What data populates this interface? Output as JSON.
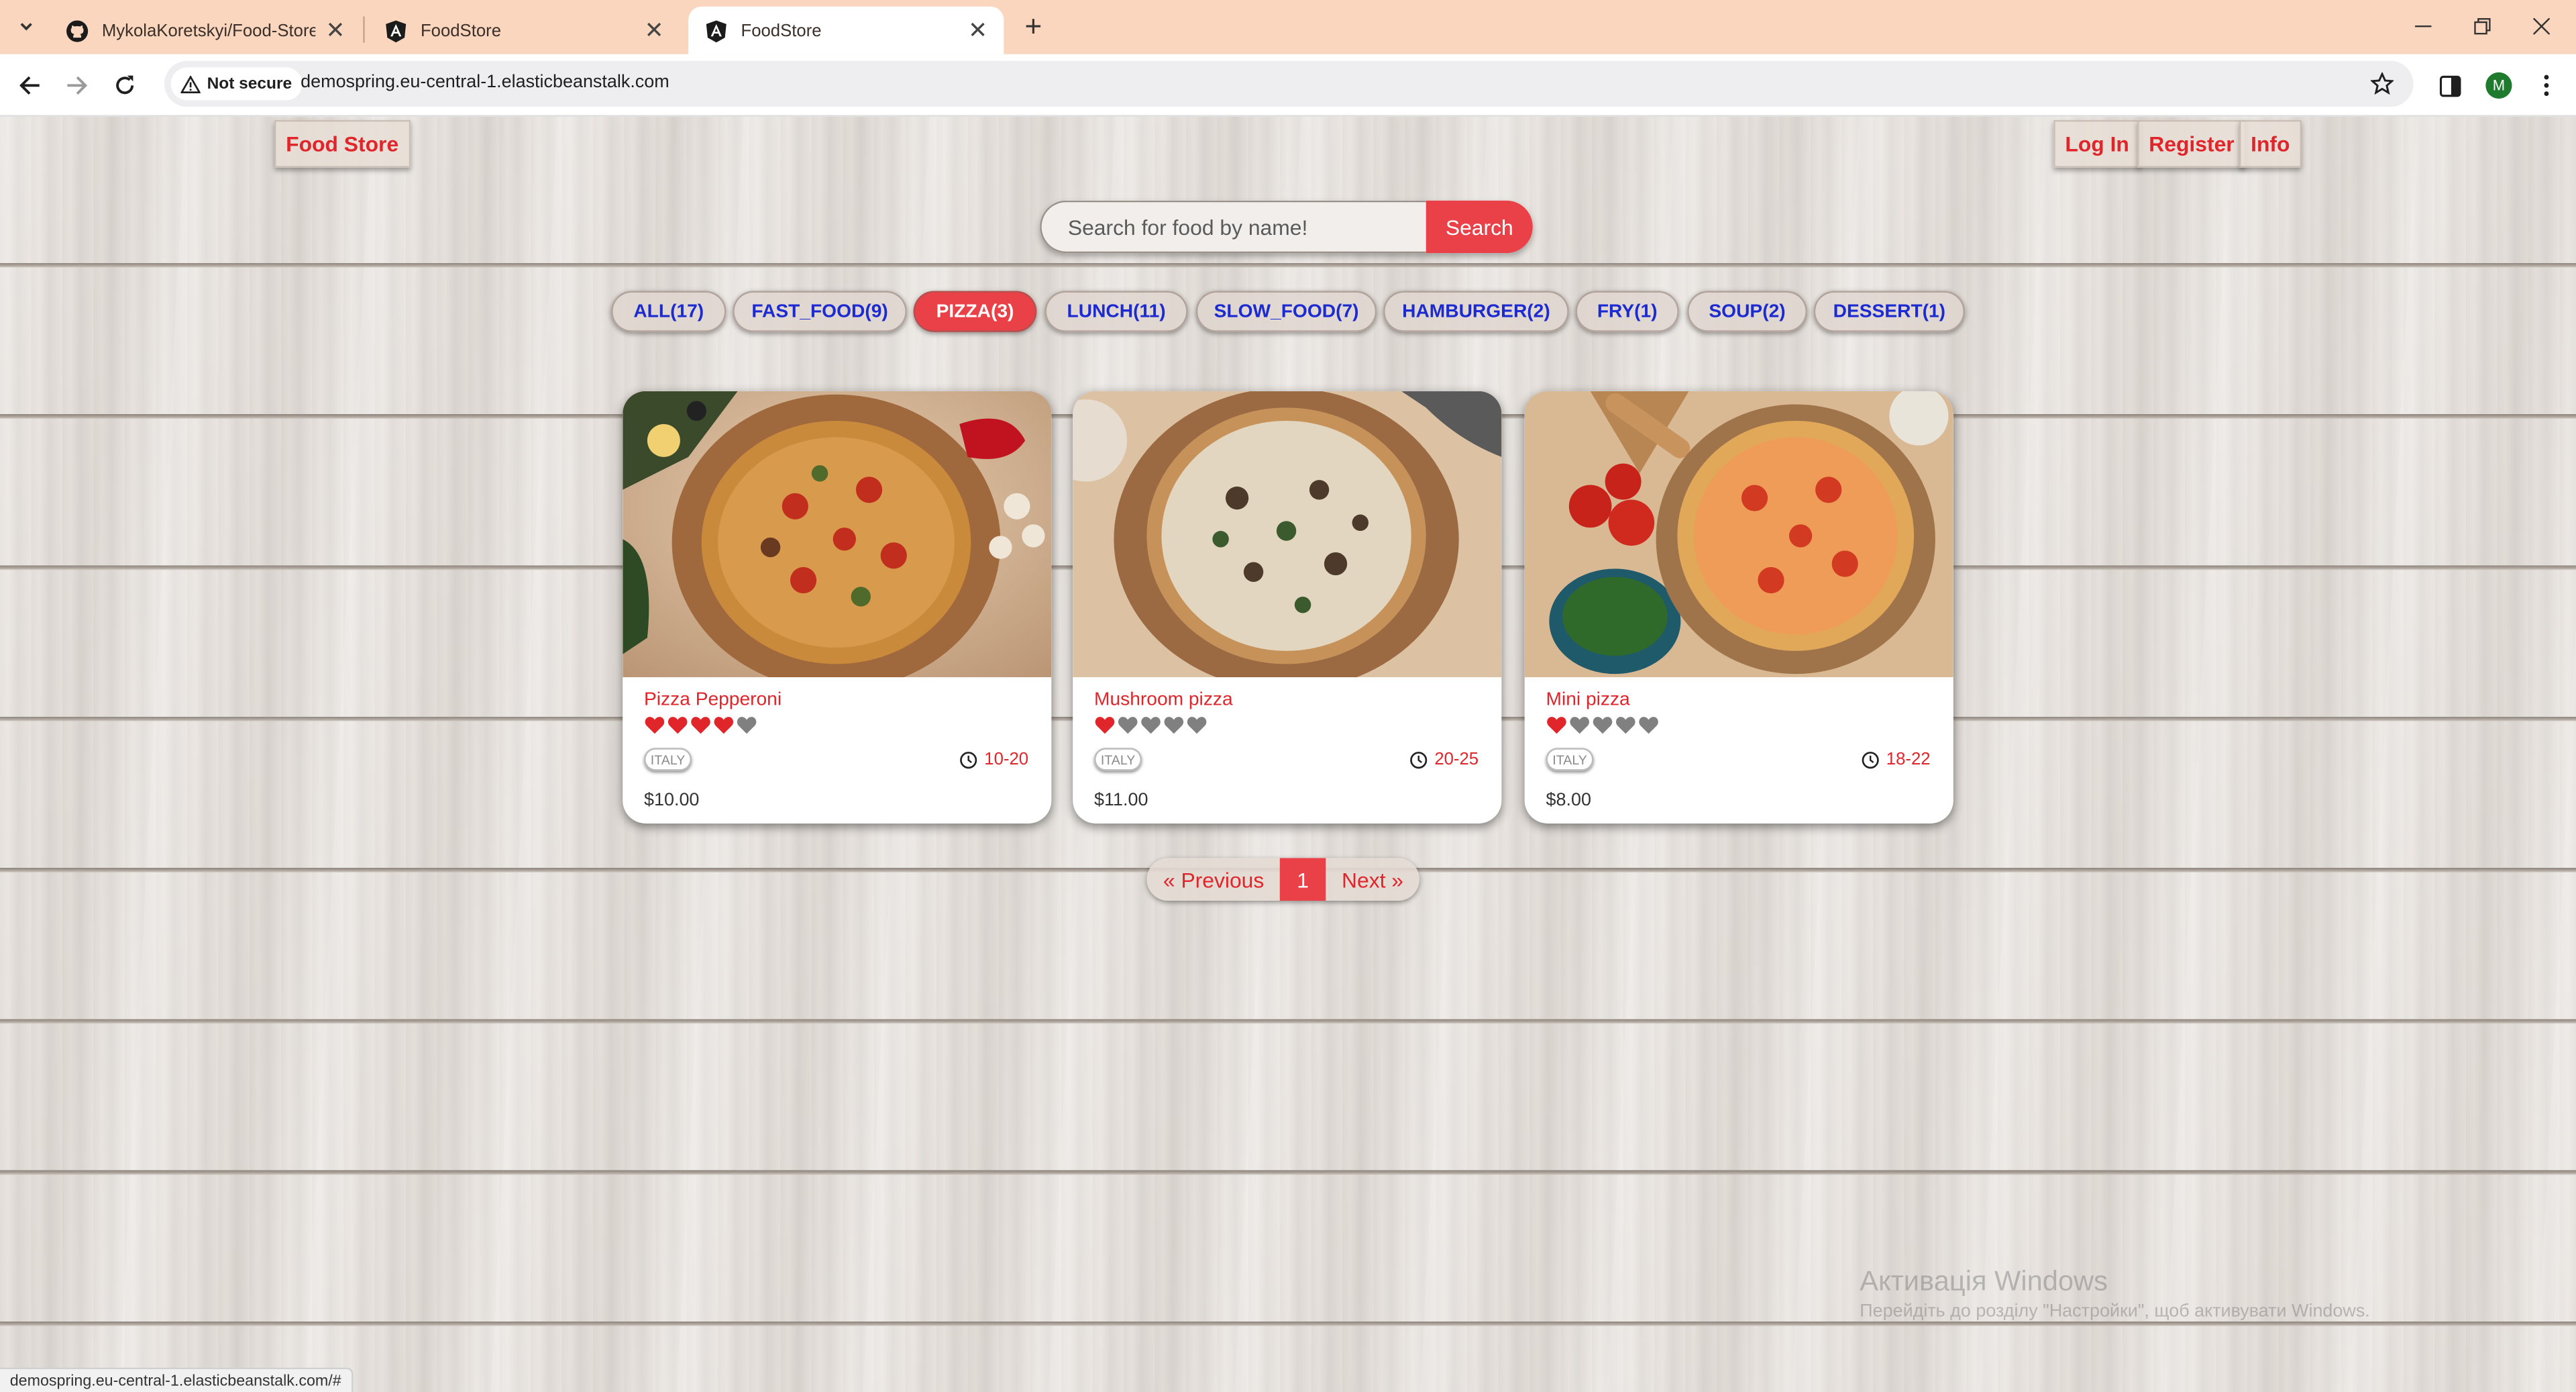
{
  "browser": {
    "tabs": [
      {
        "title": "MykolaKoretskyi/Food-Store: D",
        "icon": "github-icon"
      },
      {
        "title": "FoodStore",
        "icon": "angular-icon"
      },
      {
        "title": "FoodStore",
        "icon": "angular-icon"
      }
    ],
    "security_label": "Not secure",
    "url": "demospring.eu-central-1.elasticbeanstalk.com",
    "profile_initial": "M",
    "status_url": "demospring.eu-central-1.elasticbeanstalk.com/#"
  },
  "header": {
    "brand": "Food Store",
    "login": "Log In",
    "register": "Register",
    "info": "Info"
  },
  "search": {
    "placeholder": "Search for food by name!",
    "button": "Search"
  },
  "tags": [
    {
      "label": "ALL(17)",
      "active": false
    },
    {
      "label": "FAST_FOOD(9)",
      "active": false
    },
    {
      "label": "PIZZA(3)",
      "active": true
    },
    {
      "label": "LUNCH(11)",
      "active": false
    },
    {
      "label": "SLOW_FOOD(7)",
      "active": false
    },
    {
      "label": "HAMBURGER(2)",
      "active": false
    },
    {
      "label": "FRY(1)",
      "active": false
    },
    {
      "label": "SOUP(2)",
      "active": false
    },
    {
      "label": "DESSERT(1)",
      "active": false
    }
  ],
  "foods": [
    {
      "name": "Pizza Pepperoni",
      "rating": 4,
      "origin": "ITALY",
      "cook_time": "10-20",
      "price": "$10.00"
    },
    {
      "name": "Mushroom pizza",
      "rating": 1,
      "origin": "ITALY",
      "cook_time": "20-25",
      "price": "$11.00"
    },
    {
      "name": "Mini pizza",
      "rating": 1,
      "origin": "ITALY",
      "cook_time": "18-22",
      "price": "$8.00"
    }
  ],
  "pagination": {
    "previous": "« Previous",
    "current": "1",
    "next": "Next »"
  },
  "watermark": {
    "line1": "Активація Windows",
    "line2": "Перейдіть до розділу \"Настройки\", щоб активувати Windows."
  },
  "colors": {
    "accent": "#ea4148",
    "link_blue": "#1b2bd1",
    "heart_filled": "#e0262b",
    "heart_empty": "#808080"
  }
}
